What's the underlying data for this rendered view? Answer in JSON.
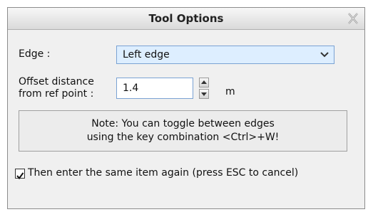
{
  "window": {
    "title": "Tool Options"
  },
  "edge": {
    "label": "Edge :",
    "selected": "Left edge"
  },
  "offset": {
    "label_line1": "Offset distance",
    "label_line2": "from ref point :",
    "value": "1.4",
    "unit": "m"
  },
  "note": {
    "line1": "Note: You can toggle between edges",
    "line2": "using the key combination <Ctrl>+W!"
  },
  "repeat": {
    "checked": true,
    "label": "Then enter the same item again (press ESC to cancel)"
  },
  "icons": {
    "close": "close-icon",
    "dropdown": "chevron-down-icon",
    "spin_up": "arrow-up-icon",
    "spin_down": "arrow-down-icon",
    "check": "check-icon"
  }
}
